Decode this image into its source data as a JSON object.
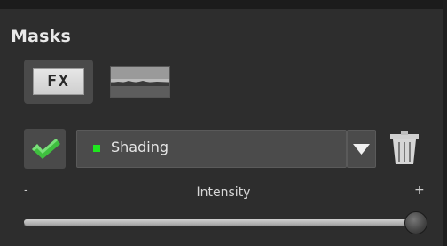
{
  "panel": {
    "title": "Masks"
  },
  "mask_type": {
    "fx_label": "FX",
    "image_icon": "landscape-thumbnail-icon"
  },
  "mask_row": {
    "enabled_icon": "checkmark-icon",
    "enabled": true,
    "dropdown": {
      "selected": "Shading",
      "status_color": "#1ee61e",
      "arrow_icon": "triangle-down-icon"
    },
    "delete_icon": "trash-icon"
  },
  "intensity": {
    "label": "Intensity",
    "min_label": "-",
    "max_label": "+",
    "level": 1.0
  },
  "colors": {
    "background": "#2d2d2d",
    "accent_green": "#1ee61e"
  }
}
